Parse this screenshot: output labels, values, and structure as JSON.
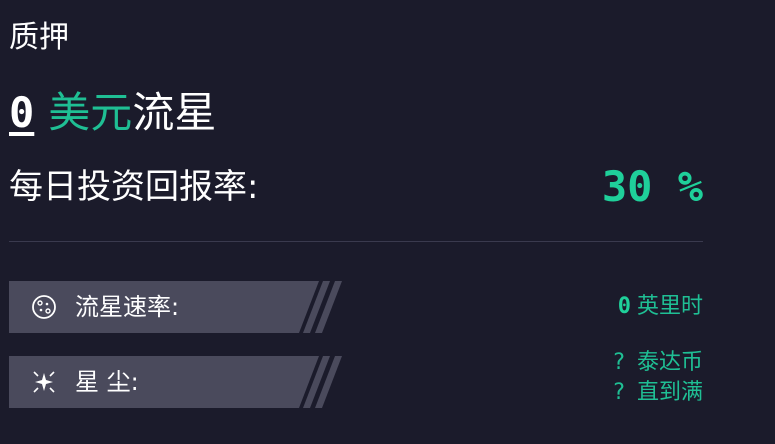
{
  "heading": "质押",
  "amount": {
    "value": "0",
    "currency": "美元",
    "unit": "流星"
  },
  "daily_rate": {
    "label": "每日投资回报率:",
    "value": "30 %"
  },
  "stats": {
    "speed": {
      "label": "流星速率:",
      "icon": "cookie-meteor-icon",
      "value_num": "0",
      "value_unit": "英里时"
    },
    "dust": {
      "label": "星 尘:",
      "icon": "sparkle-burst-icon",
      "line1_q": "?",
      "line1_text": "泰达币",
      "line2_q": "?",
      "line2_text": "直到满"
    }
  },
  "colors": {
    "background": "#1b1b2b",
    "accent": "#1fd09a",
    "tag_bg": "#4a4a5c"
  }
}
